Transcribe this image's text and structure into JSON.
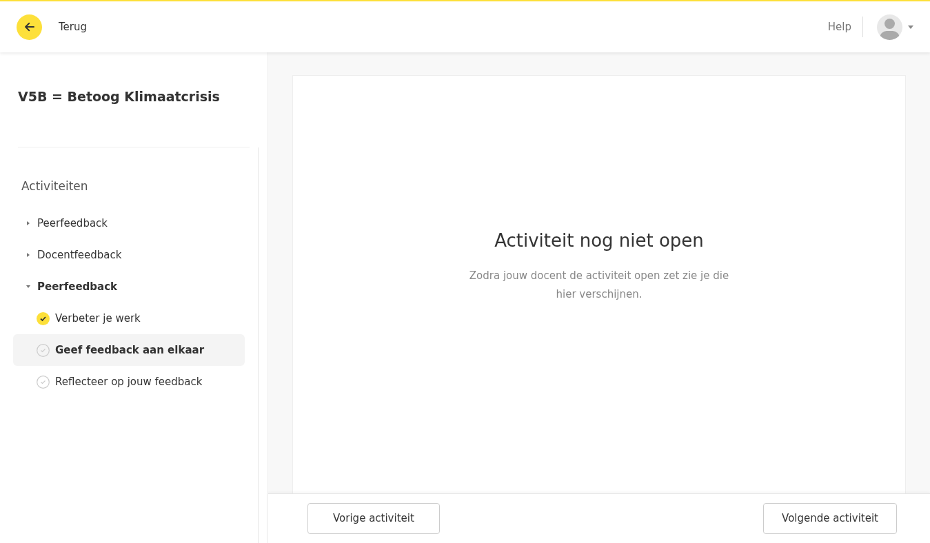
{
  "header": {
    "back_label": "Terug",
    "help": "Help"
  },
  "sidebar": {
    "title": "V5B = Betoog Klimaatcrisis",
    "section_title": "Activiteiten",
    "groups": [
      {
        "label": "Peerfeedback",
        "expanded": false
      },
      {
        "label": "Docentfeedback",
        "expanded": false
      },
      {
        "label": "Peerfeedback",
        "expanded": true,
        "children": [
          {
            "label": "Verbeter je werk",
            "done": true,
            "selected": false
          },
          {
            "label": "Geef feedback aan elkaar",
            "done": false,
            "selected": true
          },
          {
            "label": "Reflecteer op jouw feedback",
            "done": false,
            "selected": false
          }
        ]
      }
    ]
  },
  "main": {
    "heading": "Activiteit nog niet open",
    "message": "Zodra jouw docent de activiteit open zet zie je die hier verschijnen."
  },
  "footer": {
    "previous": "Vorige activiteit",
    "next": "Volgende activiteit"
  }
}
